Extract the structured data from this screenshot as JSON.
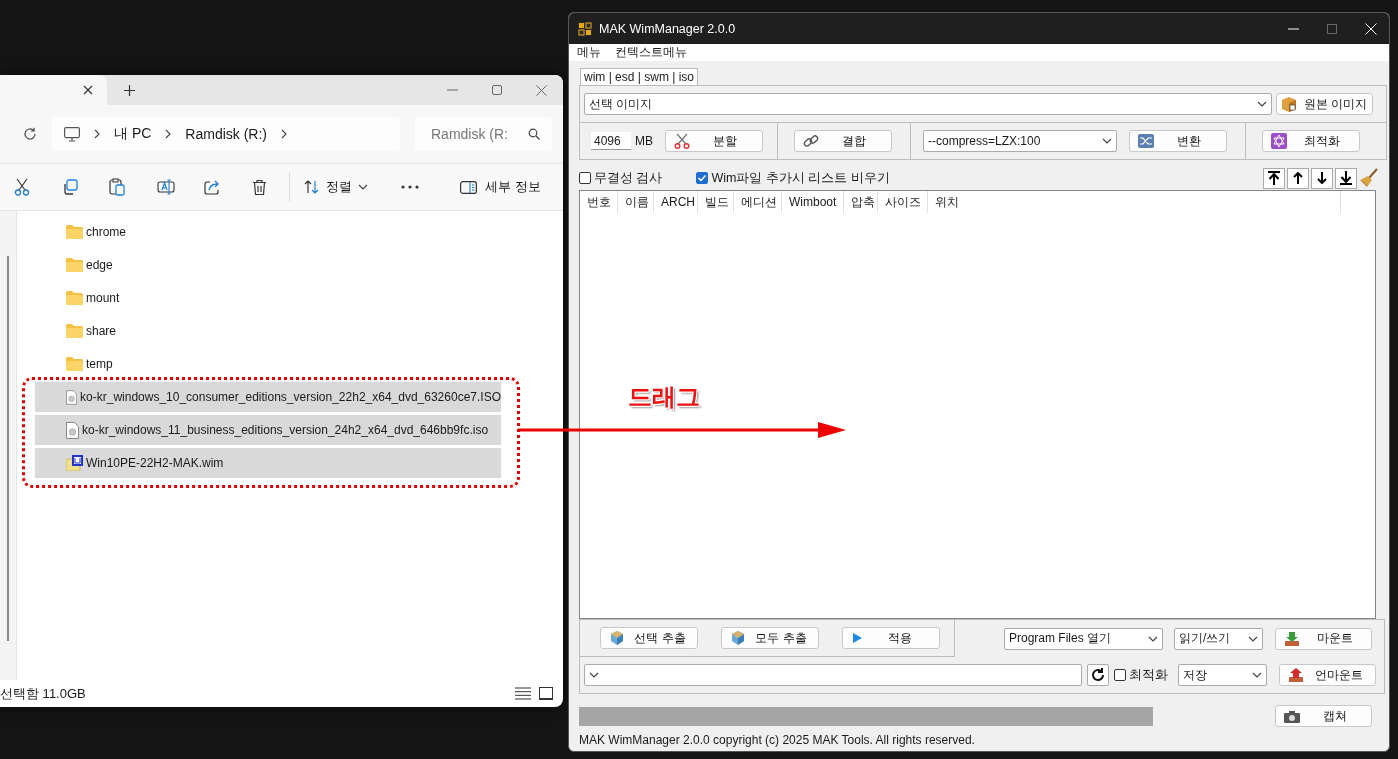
{
  "explorer": {
    "address": {
      "path": [
        "내 PC",
        "Ramdisk (R:)"
      ]
    },
    "search": {
      "placeholder": "Ramdisk (R:"
    },
    "toolbar": {
      "sort": "정렬",
      "details": "세부 정보"
    },
    "files": [
      {
        "name": "chrome",
        "kind": "folder",
        "selected": false
      },
      {
        "name": "edge",
        "kind": "folder",
        "selected": false
      },
      {
        "name": "mount",
        "kind": "folder",
        "selected": false
      },
      {
        "name": "share",
        "kind": "folder",
        "selected": false
      },
      {
        "name": "temp",
        "kind": "folder",
        "selected": false
      },
      {
        "name": "ko-kr_windows_10_consumer_editions_version_22h2_x64_dvd_63260ce7.ISO",
        "kind": "disc",
        "selected": true
      },
      {
        "name": "ko-kr_windows_11_business_editions_version_24h2_x64_dvd_646bb9fc.iso",
        "kind": "disc",
        "selected": true
      },
      {
        "name": "Win10PE-22H2-MAK.wim",
        "kind": "wim",
        "selected": true
      }
    ],
    "status": "선택함 11.0GB"
  },
  "annotation": {
    "label": "드래그"
  },
  "wim_manager": {
    "title": "MAK WimManager 2.0.0",
    "menu": [
      "메뉴",
      "컨텍스트메뉴"
    ],
    "tabs": [
      {
        "label": "wim | esd | swm | iso",
        "selected": true
      }
    ],
    "image_select": {
      "value": "선택 이미지"
    },
    "source_image_button": "원본 이미지",
    "split_size": {
      "value": "4096",
      "unit": "MB"
    },
    "split_button": "분할",
    "merge_button": "결합",
    "compress": {
      "value": "--compress=LZX:100"
    },
    "convert_button": "변환",
    "optimize_button": "최적화",
    "options": [
      {
        "label": "무결성 검사",
        "checked": false
      },
      {
        "label": "Wim파일 추가시 리스트 비우기",
        "checked": true
      }
    ],
    "table": {
      "columns": [
        "번호",
        "이름",
        "ARCH",
        "빌드",
        "에디션",
        "Wimboot",
        "압축",
        "사이즈",
        "위치"
      ]
    },
    "action_buttons": [
      {
        "label": "선택 추출",
        "kind": "extract"
      },
      {
        "label": "모두 추출",
        "kind": "extract"
      },
      {
        "label": "적용",
        "kind": "apply"
      }
    ],
    "mount_folder": {
      "value": "Program Files 열기"
    },
    "mount_mode": {
      "value": "읽기/쓰기"
    },
    "mount_button": "마운트",
    "unmount_optimize": {
      "label": "최적화",
      "checked": false
    },
    "save_mode": {
      "value": "저장"
    },
    "unmount_button": "언마운트",
    "progress": {
      "level": 1
    },
    "capture_button": "캡쳐",
    "status": "MAK WimManager 2.0.0 copyright (c) 2025 MAK Tools. All rights reserved."
  }
}
